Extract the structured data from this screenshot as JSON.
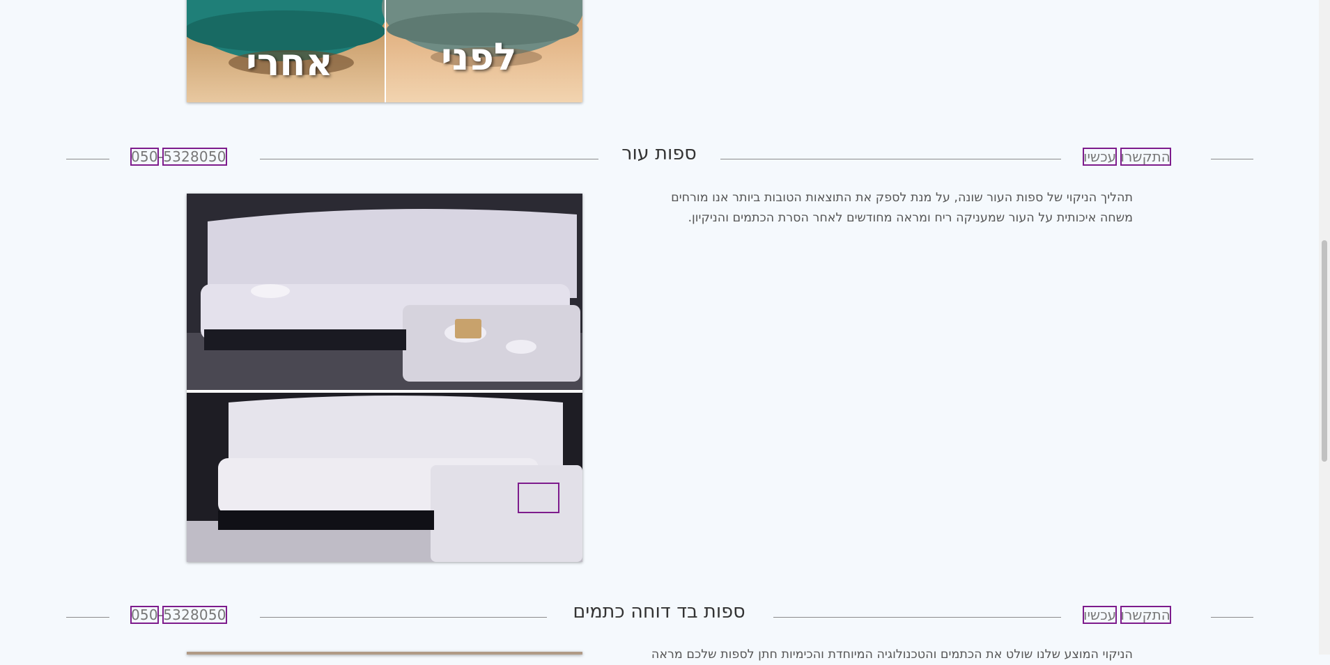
{
  "top_image": {
    "after_label": "אחרי",
    "before_label": "לפני"
  },
  "sections": [
    {
      "phone_prefix": "050",
      "phone_dash": "-",
      "phone_number": "5328050",
      "title": "ספות עור",
      "cta_word1": "התקשרו",
      "cta_word2": "עכשיו",
      "paragraph_line1": "תהליך הניקוי של ספות העור שונה, על מנת לספק את התוצאות הטובות ביותר אנו מורחים",
      "paragraph_line2": "משחה איכותית על העור שמעניקה ריח ומראה מחודשים לאחר הסרת הכתמים והניקיון."
    },
    {
      "phone_prefix": "050",
      "phone_dash": "-",
      "phone_number": "5328050",
      "title": "ספות בד דוחה כתמים",
      "cta_word1": "התקשרו",
      "cta_word2": "עכשיו",
      "paragraph_line1": "הניקוי המוצע שלנו שולט את הכתמים והטכנולוגיה המיוחדת והכימיות חתן לספות שלכם מראה"
    }
  ],
  "colors": {
    "background": "#f5f9fd",
    "highlight_outline": "#7d1b8c",
    "divider": "#8a8a8a"
  }
}
